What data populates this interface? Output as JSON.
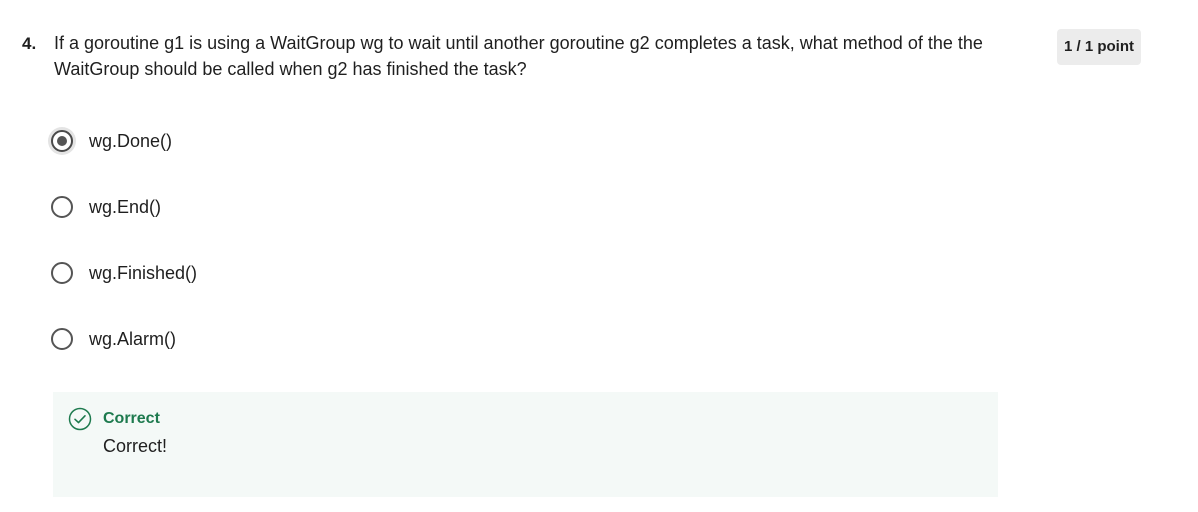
{
  "question": {
    "number": "4.",
    "text": "If a goroutine g1 is using a WaitGroup wg to wait until another goroutine g2 completes a task, what method of the the WaitGroup should be called when g2 has finished the task?"
  },
  "score": {
    "label": "1 / 1 point"
  },
  "options": [
    {
      "label": "wg.Done()",
      "selected": true
    },
    {
      "label": "wg.End()",
      "selected": false
    },
    {
      "label": "wg.Finished()",
      "selected": false
    },
    {
      "label": "wg.Alarm()",
      "selected": false
    }
  ],
  "feedback": {
    "title": "Correct",
    "message": "Correct!",
    "icon": "check-circle-icon",
    "color": "#1d7a4e"
  }
}
